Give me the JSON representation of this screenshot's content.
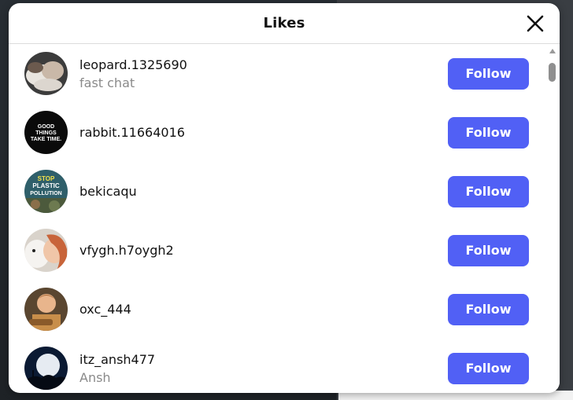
{
  "modal": {
    "title": "Likes",
    "close_icon": "close-icon",
    "follow_button_color": "#5160f5"
  },
  "users": [
    {
      "username": "leopard.1325690",
      "subtitle": "fast chat",
      "button": "Follow"
    },
    {
      "username": "rabbit.11664016",
      "subtitle": "",
      "button": "Follow",
      "avatar_text": "GOOD THINGS TAKE TIME."
    },
    {
      "username": "bekicaqu",
      "subtitle": "",
      "button": "Follow",
      "avatar_text": "STOP PLASTIC POLLUTION"
    },
    {
      "username": "vfygh.h7oygh2",
      "subtitle": "",
      "button": "Follow"
    },
    {
      "username": "oxc_444",
      "subtitle": "",
      "button": "Follow"
    },
    {
      "username": "itz_ansh477",
      "subtitle": "Ansh",
      "button": "Follow"
    }
  ]
}
